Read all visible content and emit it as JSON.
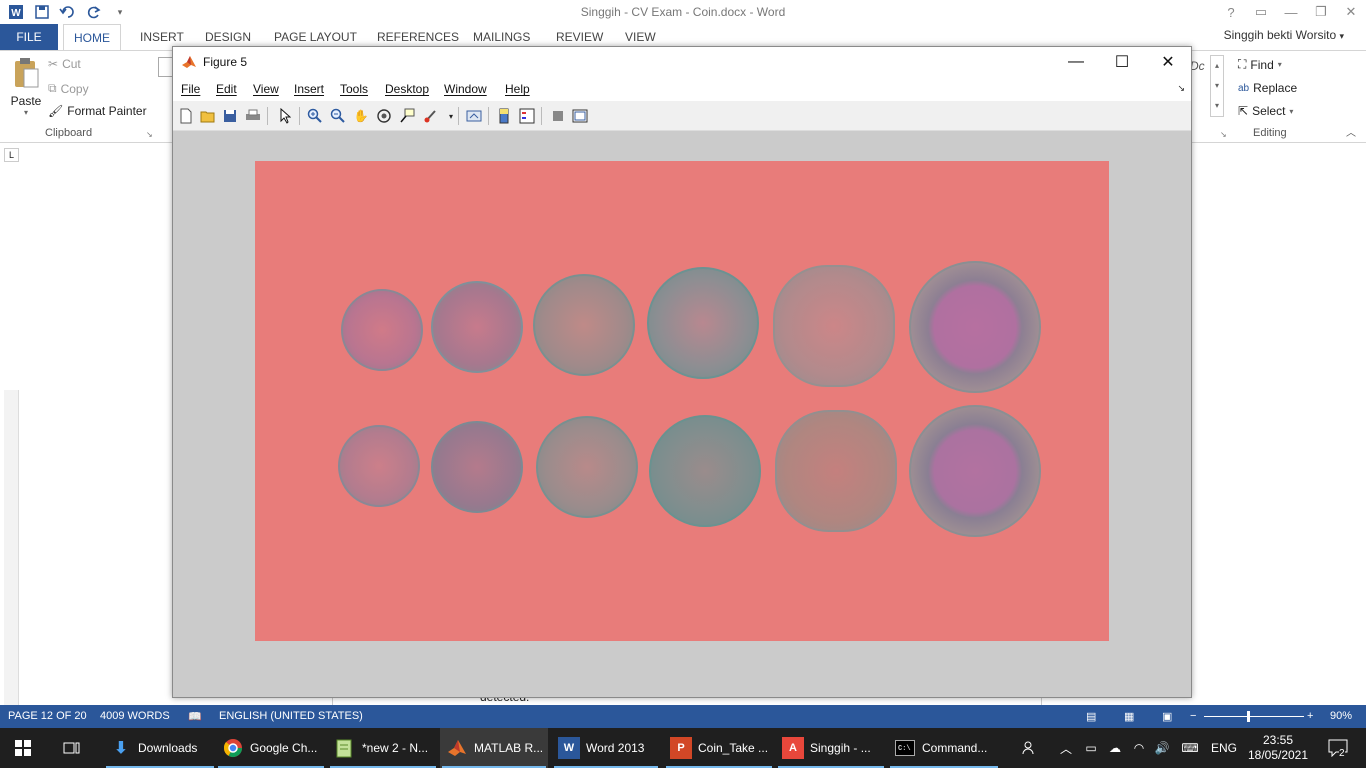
{
  "word": {
    "title": "Singgih - CV Exam - Coin.docx - Word",
    "help": "?",
    "user": "Singgih bekti Worsito",
    "tabs": [
      "FILE",
      "HOME",
      "INSERT",
      "DESIGN",
      "PAGE LAYOUT",
      "REFERENCES",
      "MAILINGS",
      "REVIEW",
      "VIEW"
    ],
    "active_tab": "HOME",
    "clipboard": {
      "paste": "Paste",
      "cut": "Cut",
      "copy": "Copy",
      "format_painter": "Format Painter",
      "group_label": "Clipboard"
    },
    "editing": {
      "find": "Find",
      "replace": "Replace",
      "select": "Select",
      "group_label": "Editing"
    },
    "style_preview": "Dc",
    "doc_fragment": "detected.",
    "ruler_tab": "L"
  },
  "figure": {
    "title": "Figure 5",
    "menus": [
      "File",
      "Edit",
      "View",
      "Insert",
      "Tools",
      "Desktop",
      "Window",
      "Help"
    ],
    "image_bg_color": "#e87c7a",
    "canvas_color": "#cbcbcb"
  },
  "status": {
    "page": "PAGE 12 OF 20",
    "words": "4009 WORDS",
    "language": "ENGLISH (UNITED STATES)",
    "zoom": "90%"
  },
  "taskbar": {
    "apps": [
      {
        "label": "Downloads",
        "icon": "downloads-icon"
      },
      {
        "label": "Google Ch...",
        "icon": "chrome-icon"
      },
      {
        "label": "*new 2 - N...",
        "icon": "notepadpp-icon"
      },
      {
        "label": "MATLAB R...",
        "icon": "matlab-icon"
      },
      {
        "label": "Word 2013",
        "icon": "word-icon"
      },
      {
        "label": "Coin_Take ...",
        "icon": "powerpoint-icon"
      },
      {
        "label": "Singgih - ...",
        "icon": "acrobat-icon"
      },
      {
        "label": "Command...",
        "icon": "cmd-icon"
      }
    ],
    "active_app": "MATLAB R...",
    "lang": "ENG",
    "time": "23:55",
    "date": "18/05/2021",
    "notification_count": "2"
  }
}
